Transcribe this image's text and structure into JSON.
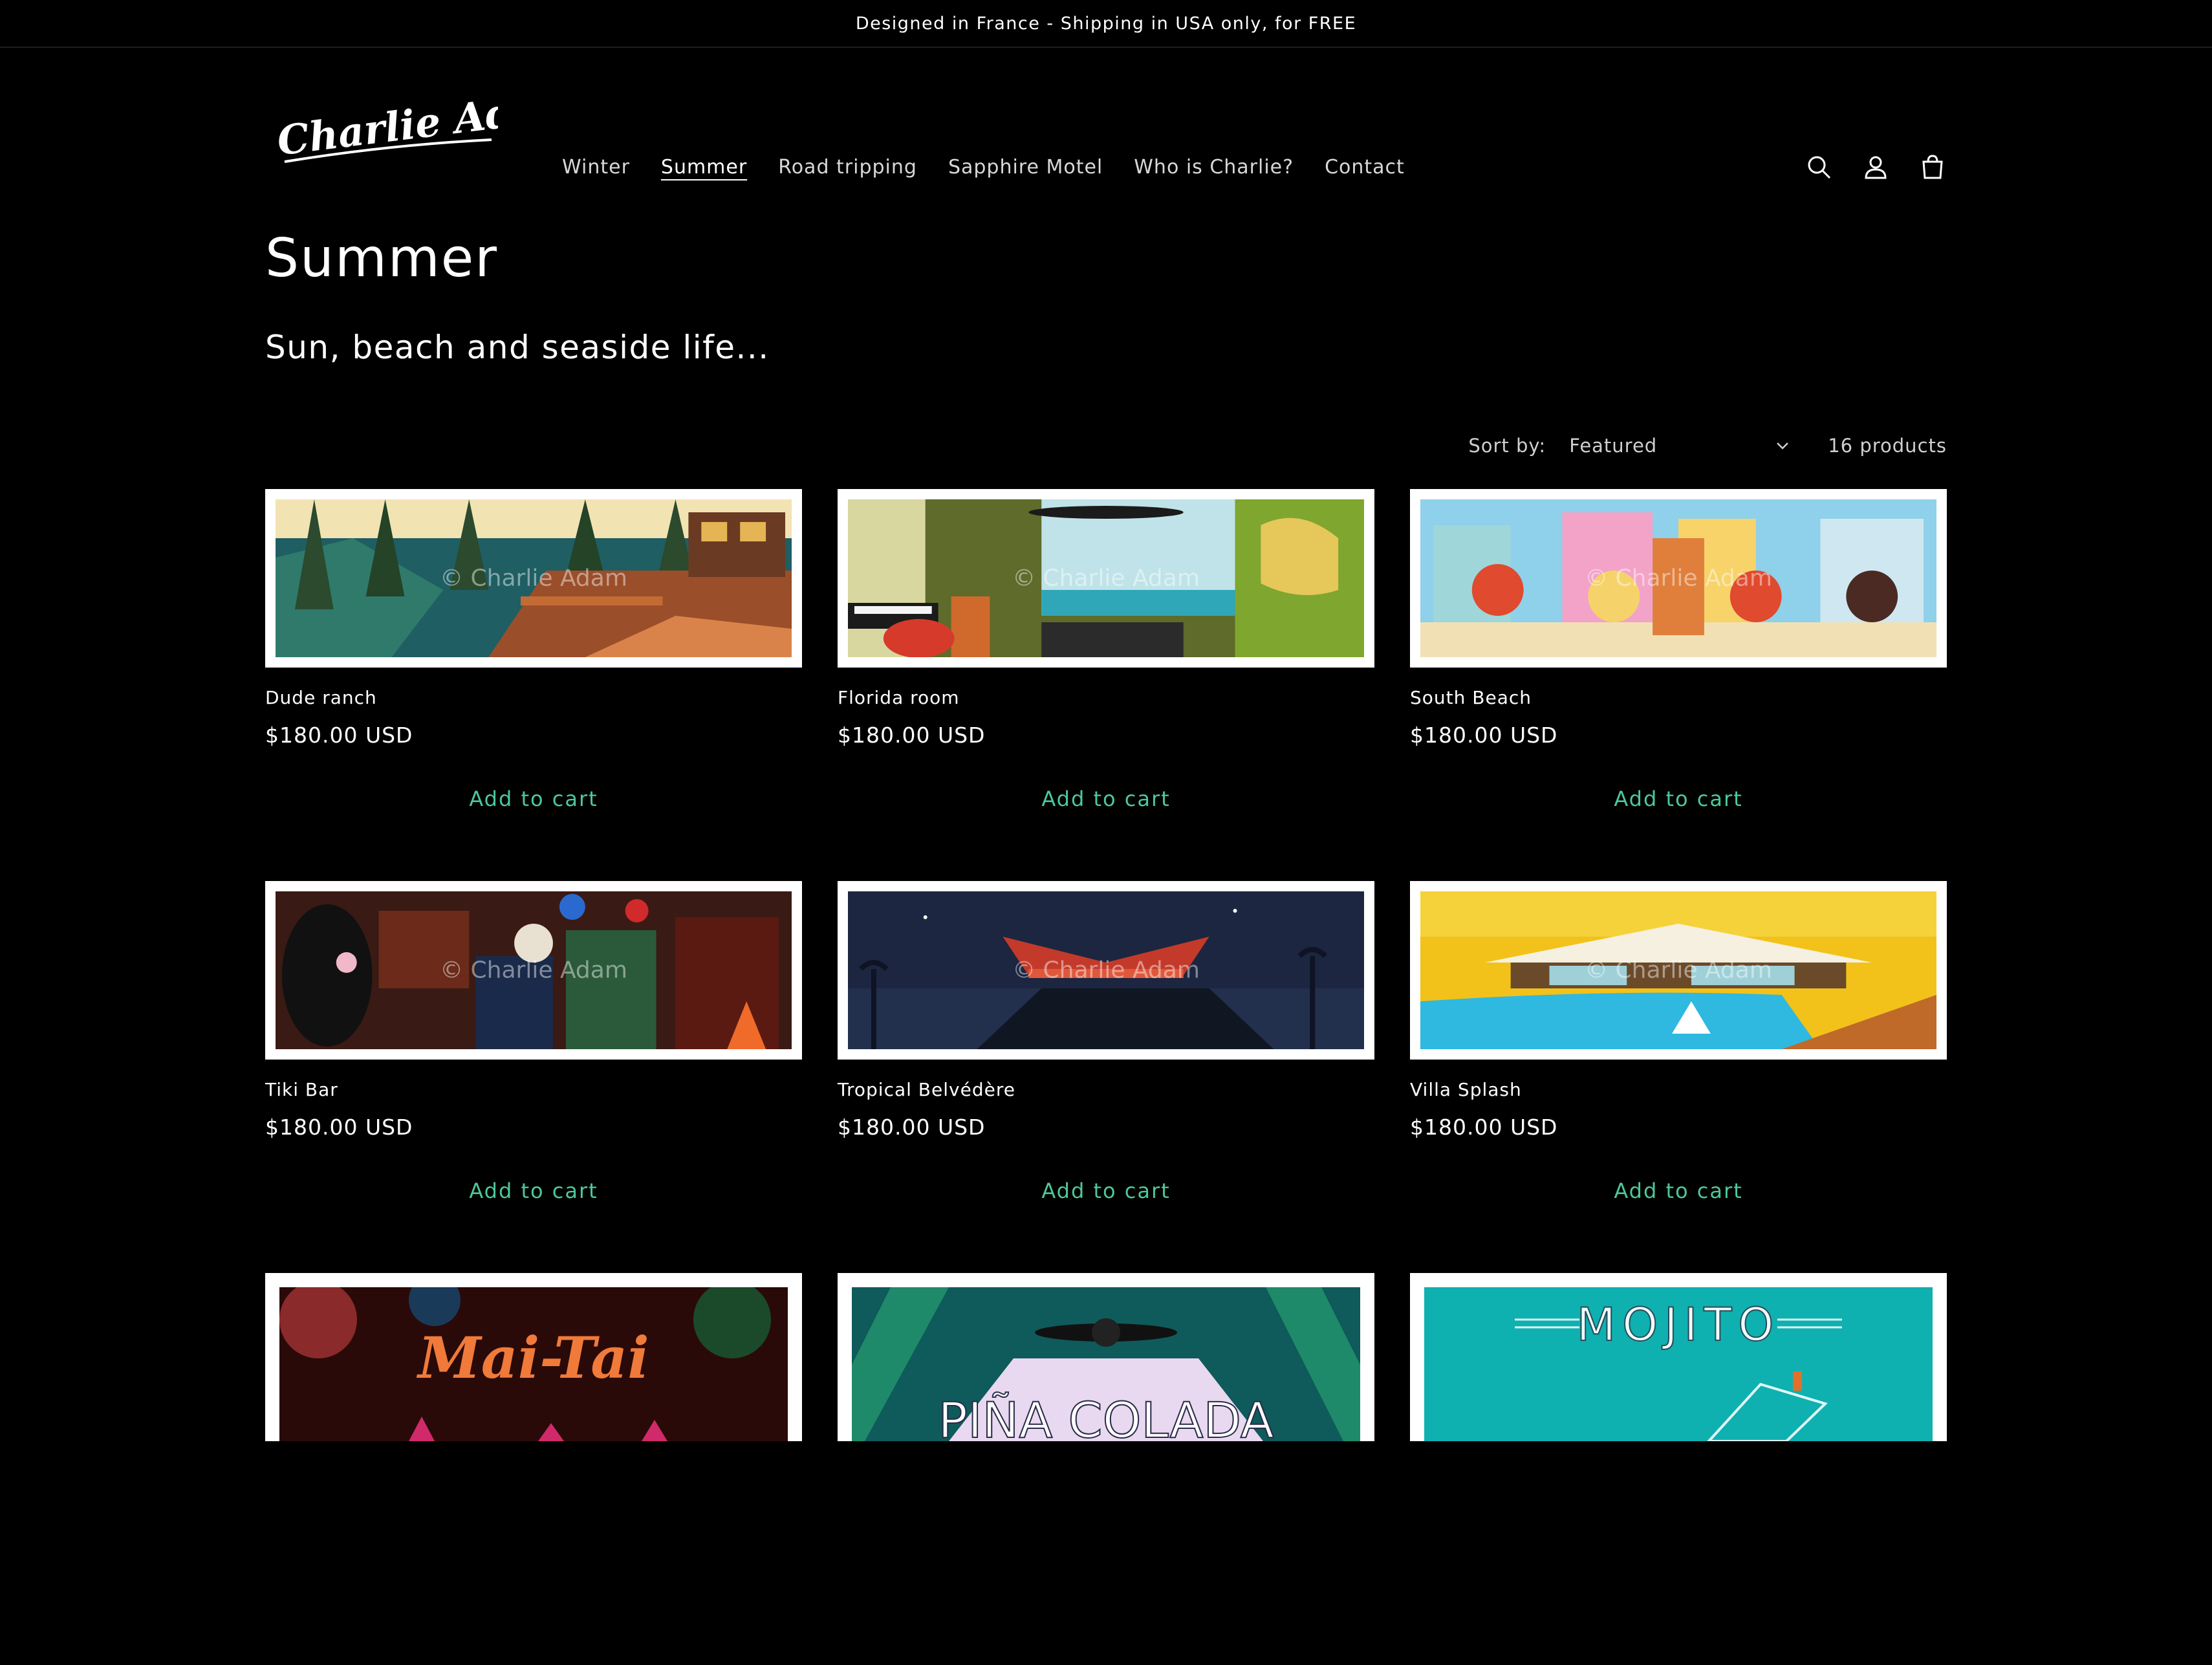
{
  "announcement": "Designed in France - Shipping in USA only, for FREE",
  "logo_text": "Charlie Adam",
  "nav": [
    {
      "label": "Winter",
      "active": false
    },
    {
      "label": "Summer",
      "active": true
    },
    {
      "label": "Road tripping",
      "active": false
    },
    {
      "label": "Sapphire Motel",
      "active": false
    },
    {
      "label": "Who is Charlie?",
      "active": false
    },
    {
      "label": "Contact",
      "active": false
    }
  ],
  "icons": [
    "search-icon",
    "account-icon",
    "cart-icon"
  ],
  "page": {
    "title": "Summer",
    "description": "Sun, beach and seaside life..."
  },
  "toolbar": {
    "sort_label": "Sort by:",
    "sort_value": "Featured",
    "count": "16 products"
  },
  "watermark": "© Charlie Adam",
  "products": [
    {
      "name": "Dude ranch",
      "price": "$180.00 USD",
      "cta": "Add to cart"
    },
    {
      "name": "Florida room",
      "price": "$180.00 USD",
      "cta": "Add to cart"
    },
    {
      "name": "South Beach",
      "price": "$180.00 USD",
      "cta": "Add to cart"
    },
    {
      "name": "Tiki Bar",
      "price": "$180.00 USD",
      "cta": "Add to cart"
    },
    {
      "name": "Tropical Belvédère",
      "price": "$180.00 USD",
      "cta": "Add to cart"
    },
    {
      "name": "Villa Splash",
      "price": "$180.00 USD",
      "cta": "Add to cart"
    }
  ],
  "posters": [
    {
      "text": "Mai-Tai"
    },
    {
      "text": "PIÑA COLADA"
    },
    {
      "text": "MOJITO"
    }
  ],
  "colors": {
    "background": "#000000",
    "accent": "#4cc99a",
    "text": "#ffffff"
  }
}
